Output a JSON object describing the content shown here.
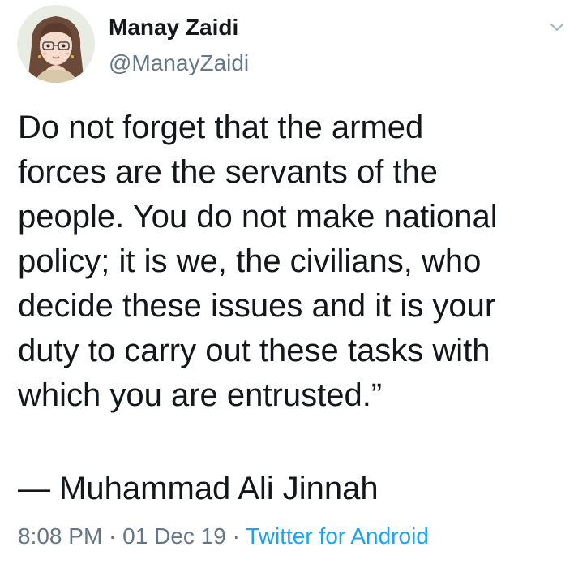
{
  "user": {
    "name": "Manay Zaidi",
    "handle": "@ManayZaidi",
    "avatar_icon": "avatar-illustration-icon"
  },
  "menu": {
    "icon": "chevron-down-icon"
  },
  "tweet": {
    "lines": [
      "Do not forget that the armed",
      "forces are the servants of the",
      "people. You do not make national",
      "policy; it is we, the civilians, who",
      "decide these issues and it is your",
      "duty to carry out these tasks with",
      "which you are entrusted.”"
    ],
    "attribution": "— Muhammad Ali Jinnah"
  },
  "meta": {
    "time": "8:08 PM",
    "separator": " · ",
    "date": "01 Dec 19",
    "source": "Twitter for Android"
  },
  "colors": {
    "text": "#14171a",
    "secondary": "#657786",
    "link": "#1da1f2"
  }
}
